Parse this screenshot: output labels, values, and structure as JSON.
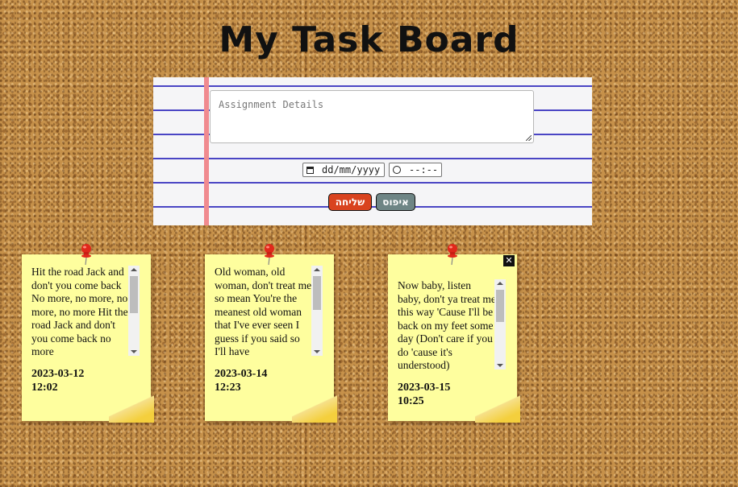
{
  "title": "My Task Board",
  "form": {
    "details_placeholder": "Assignment Details",
    "date_placeholder": "dd/mm/yyyy",
    "time_placeholder": "--:--",
    "send_label": "שליחה",
    "reset_label": "איפוס"
  },
  "notes": [
    {
      "text": "Hit the road Jack and don't you come back No more, no more, no more, no more Hit the road Jack and don't you come back no more",
      "date": "2023-03-12",
      "time": "12:02"
    },
    {
      "text": "Old woman, old woman, don't treat me so mean You're the meanest old woman that I've ever seen I guess if you said so I'll have",
      "date": "2023-03-14",
      "time": "12:23"
    },
    {
      "text": "Now baby, listen baby, don't ya treat me this way 'Cause I'll be back on my feet some day (Don't care if you do 'cause it's understood)",
      "date": "2023-03-15",
      "time": "10:25",
      "close_label": "✕"
    }
  ],
  "colors": {
    "cork": "#c6914a",
    "paper_line": "#4a45c4",
    "paper_margin": "#f08a8f",
    "send_button": "#d9431f",
    "reset_button": "#6e8585",
    "note": "#fefe9e"
  }
}
